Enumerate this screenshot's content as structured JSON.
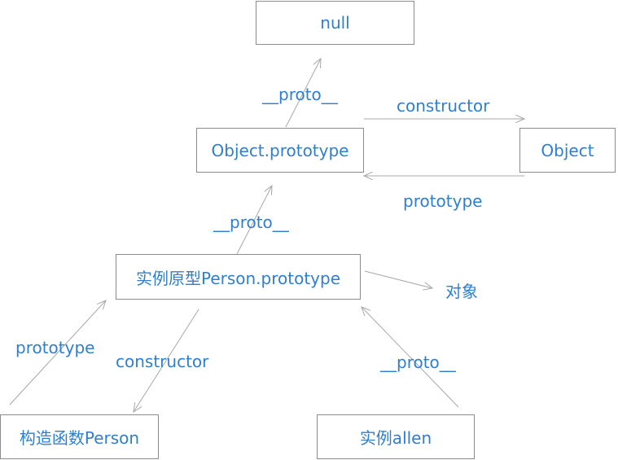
{
  "colors": {
    "text": "#2f7fd0",
    "border": "#8c8c8c",
    "line": "#a8a8a8"
  },
  "nodes": {
    "null": "null",
    "object_prototype": "Object.prototype",
    "object": "Object",
    "person_prototype": "实例原型Person.prototype",
    "constructor_person": "构造函数Person",
    "instance_allen": "实例allen"
  },
  "free_labels": {
    "object_word": "对象"
  },
  "edge_labels": {
    "objproto_to_null": "__proto__",
    "objproto_to_object": "constructor",
    "object_to_objproto": "prototype",
    "personproto_to_objproto": "__proto__",
    "person_ctor_to_proto": "prototype",
    "proto_to_person_ctor": "constructor",
    "allen_to_proto": "__proto__"
  }
}
